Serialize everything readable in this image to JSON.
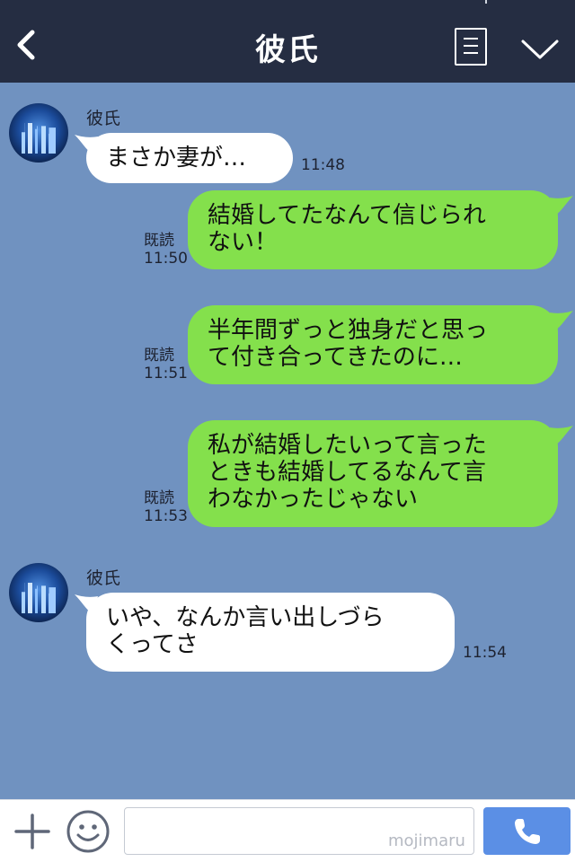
{
  "header": {
    "title": "彼氏",
    "back_icon": "chevron-left-icon",
    "menu_icon": "menu-list-icon",
    "more_icon": "chevron-down-icon",
    "background_color": "#252d42"
  },
  "chat": {
    "background_color": "#7092c0",
    "messages": [
      {
        "sender": "彼氏",
        "side": "left",
        "text": "まさか妻が…",
        "time": "11:48"
      },
      {
        "side": "right",
        "lines": [
          "結婚してたなんて信じられ",
          "ない！"
        ],
        "read": "既読",
        "time": "11:50"
      },
      {
        "side": "right",
        "lines": [
          "半年間ずっと独身だと思っ",
          "て付き合ってきたのに…"
        ],
        "read": "既読",
        "time": "11:51"
      },
      {
        "side": "right",
        "lines": [
          "私が結婚したいって言った",
          "ときも結婚してるなんて言",
          "わなかったじゃない"
        ],
        "read": "既読",
        "time": "11:53"
      },
      {
        "sender": "彼氏",
        "side": "left",
        "lines": [
          "いや、なんか言い出しづら",
          "くってさ"
        ],
        "time": "11:54"
      }
    ],
    "bubble_colors": {
      "left": "#ffffff",
      "right": "#84e04c"
    }
  },
  "footer": {
    "plus_icon": "plus-icon",
    "emoji_icon": "smiley-icon",
    "input_value": "",
    "watermark": "mojimaru",
    "call_icon": "phone-icon",
    "call_color": "#5b8fe5"
  }
}
